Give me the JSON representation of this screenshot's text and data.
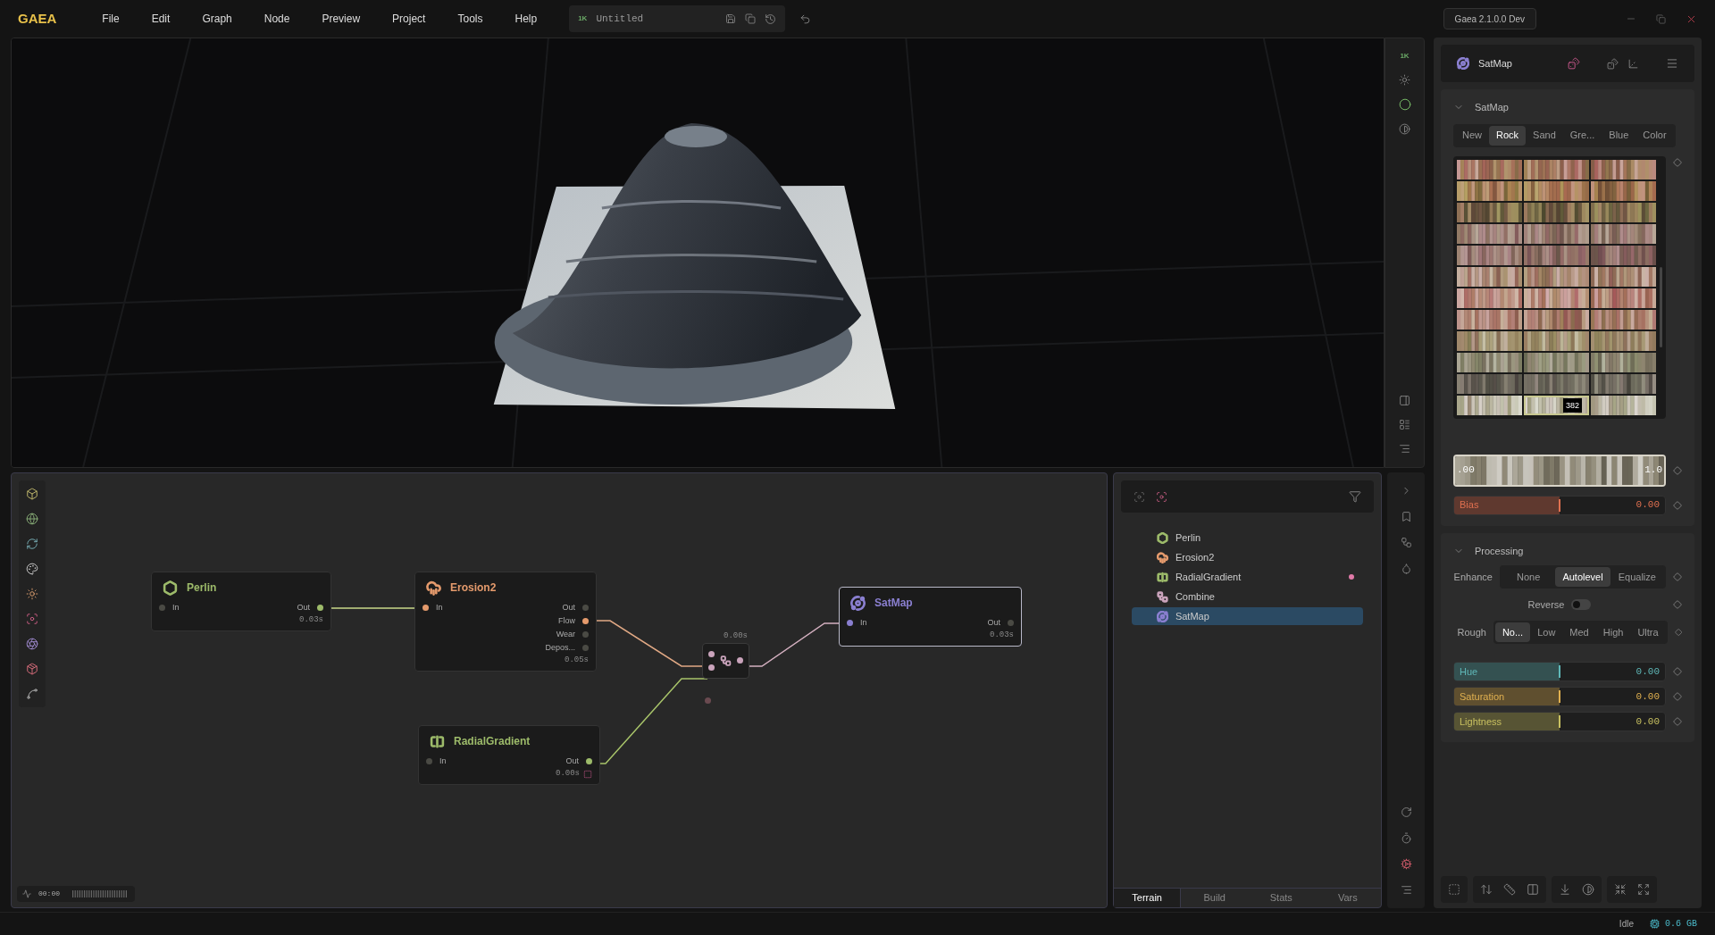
{
  "app": {
    "logo": "GAEA",
    "menu": [
      "File",
      "Edit",
      "Graph",
      "Node",
      "Preview",
      "Project",
      "Tools",
      "Help"
    ],
    "document": {
      "resolution": "1K",
      "title": "Untitled"
    },
    "version": "Gaea 2.1.0.0 Dev"
  },
  "viewport": {
    "resolution": "1K"
  },
  "graph": {
    "timeline": "00:00",
    "nodes": [
      {
        "title": "Perlin",
        "kind": "noise",
        "color": "#9dbb6a",
        "time": "0.03s",
        "inputs": [
          {
            "name": "In",
            "connected": false
          }
        ],
        "outputs": [
          {
            "name": "Out",
            "connected": true
          }
        ]
      },
      {
        "title": "Erosion2",
        "kind": "erosion",
        "color": "#e49a6c",
        "time": "0.05s",
        "inputs": [
          {
            "name": "In",
            "connected": true
          }
        ],
        "outputs": [
          {
            "name": "Out",
            "connected": false
          },
          {
            "name": "Flow",
            "connected": true
          },
          {
            "name": "Wear",
            "connected": false
          },
          {
            "name": "Depos...",
            "connected": false
          }
        ]
      },
      {
        "kind": "combine",
        "color": "#c9a3bb",
        "time": "0.00s",
        "inputs": [
          {
            "connected": true
          },
          {
            "connected": true
          }
        ],
        "outputs": [
          {
            "connected": true
          }
        ]
      },
      {
        "title": "SatMap",
        "kind": "colorize",
        "color": "#8a7fd0",
        "time": "0.03s",
        "selected": true,
        "inputs": [
          {
            "name": "In",
            "connected": true
          }
        ],
        "outputs": [
          {
            "name": "Out",
            "connected": false
          }
        ]
      },
      {
        "title": "RadialGradient",
        "kind": "gradient",
        "color": "#9dbb6a",
        "time": "0.00s",
        "inputs": [
          {
            "name": "In",
            "connected": false
          }
        ],
        "outputs": [
          {
            "name": "Out",
            "connected": true
          }
        ]
      }
    ]
  },
  "node_list": {
    "items": [
      {
        "label": "Perlin",
        "kind": "noise",
        "color": "#9dbb6a",
        "flagged": false,
        "selected": false
      },
      {
        "label": "Erosion2",
        "kind": "erosion",
        "color": "#e49a6c",
        "flagged": false,
        "selected": false
      },
      {
        "label": "RadialGradient",
        "kind": "gradient",
        "color": "#9dbb6a",
        "flagged": true,
        "selected": false
      },
      {
        "label": "Combine",
        "kind": "combine",
        "color": "#c9a3bb",
        "flagged": false,
        "selected": false
      },
      {
        "label": "SatMap",
        "kind": "colorize",
        "color": "#8a7fd0",
        "flagged": false,
        "selected": true
      }
    ],
    "tabs": [
      {
        "label": "Terrain",
        "selected": true
      },
      {
        "label": "Build",
        "selected": false
      },
      {
        "label": "Stats",
        "selected": false
      },
      {
        "label": "Vars",
        "selected": false
      }
    ]
  },
  "properties": {
    "title": "SatMap",
    "satmap": {
      "title": "SatMap",
      "tabs": [
        {
          "label": "New",
          "selected": false
        },
        {
          "label": "Rock",
          "selected": true
        },
        {
          "label": "Sand",
          "selected": false
        },
        {
          "label": "Gre...",
          "selected": false
        },
        {
          "label": "Blue",
          "selected": false
        },
        {
          "label": "Color",
          "selected": false
        }
      ],
      "swatches": [
        {
          "selected": false
        },
        {
          "selected": false
        },
        {
          "selected": false
        },
        {
          "selected": false
        },
        {
          "selected": false
        },
        {
          "selected": false
        },
        {
          "selected": false
        },
        {
          "selected": false
        },
        {
          "selected": false
        },
        {
          "selected": false
        },
        {
          "selected": false
        },
        {
          "selected": false
        },
        {
          "selected": false
        },
        {
          "selected": false
        },
        {
          "selected": false
        },
        {
          "selected": false
        },
        {
          "selected": false
        },
        {
          "selected": false
        },
        {
          "selected": false
        },
        {
          "selected": false
        },
        {
          "selected": false
        },
        {
          "selected": false
        },
        {
          "selected": false
        },
        {
          "selected": false
        },
        {
          "selected": false
        },
        {
          "selected": false
        },
        {
          "selected": false
        },
        {
          "selected": false
        },
        {
          "selected": false
        },
        {
          "selected": false
        },
        {
          "selected": false
        },
        {
          "selected": false
        },
        {
          "selected": false
        },
        {
          "selected": false
        },
        {
          "selected": true,
          "badge": "382"
        },
        {
          "selected": false
        }
      ],
      "range": {
        "min": ".00",
        "max": "1.0"
      },
      "bias": {
        "label": "Bias",
        "value": "0.00",
        "level": 0.5,
        "color": "#e07050"
      }
    },
    "processing": {
      "title": "Processing",
      "enhance": {
        "label": "Enhance",
        "options": [
          {
            "label": "None",
            "selected": false
          },
          {
            "label": "Autolevel",
            "selected": true
          },
          {
            "label": "Equalize",
            "selected": false
          }
        ]
      },
      "reverse": {
        "label": "Reverse",
        "on": false
      },
      "rough": {
        "label": "Rough",
        "options": [
          {
            "label": "No...",
            "selected": true
          },
          {
            "label": "Low",
            "selected": false
          },
          {
            "label": "Med",
            "selected": false
          },
          {
            "label": "High",
            "selected": false
          },
          {
            "label": "Ultra",
            "selected": false
          }
        ]
      },
      "sliders": [
        {
          "label": "Hue",
          "value": "0.00",
          "level": 0.5,
          "color": "#5fb8b8"
        },
        {
          "label": "Saturation",
          "value": "0.00",
          "level": 0.5,
          "color": "#e0b050"
        },
        {
          "label": "Lightness",
          "value": "0.00",
          "level": 0.5,
          "color": "#c8c060"
        }
      ]
    }
  },
  "status_bar": {
    "state": "Idle",
    "memory": "0.6 GB"
  }
}
